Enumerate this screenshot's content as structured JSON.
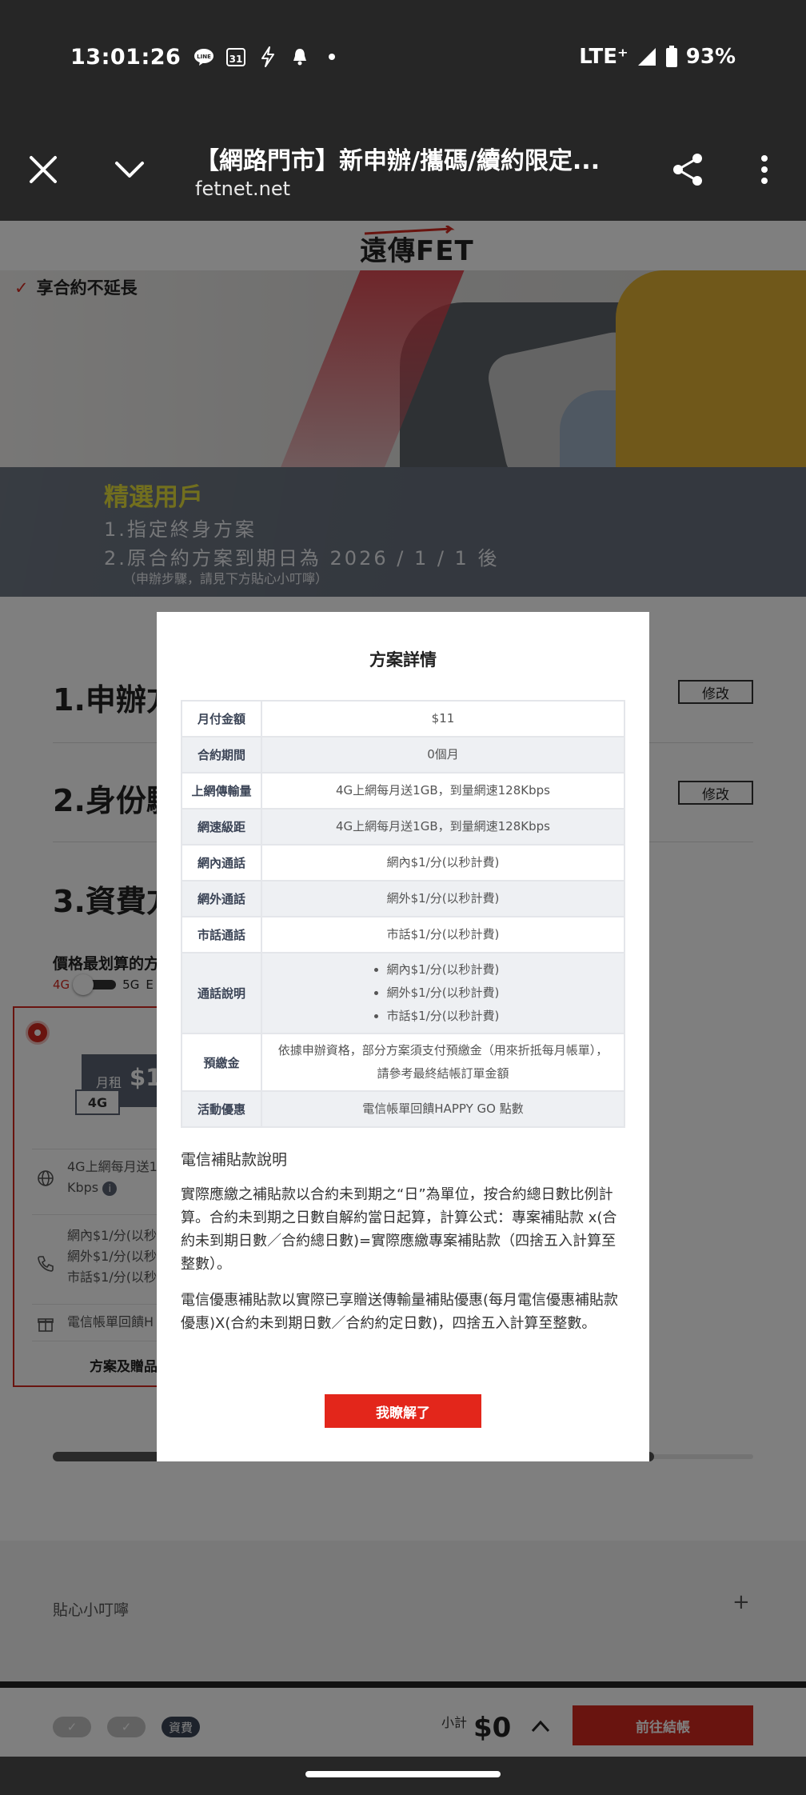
{
  "status_bar": {
    "time": "13:01:26",
    "icons": [
      "line-icon",
      "calendar-31-icon",
      "flash-icon",
      "bell-icon",
      "dot-icon"
    ],
    "calendar_day": "31",
    "network": "LTE⁺",
    "battery": "93%"
  },
  "browser": {
    "title": "【網路門市】新申辦/攜碼/續約限定...",
    "url": "fetnet.net"
  },
  "page": {
    "logo_text": "遠傳FET",
    "banner_check": "享合約不延長",
    "promo": {
      "heading": "精選用戶",
      "line1": "1.指定終身方案",
      "line2": "2.原合約方案到期日為 2026 / 1 / 1 後",
      "note": "（申辦步驟，請見下方貼心小叮嚀）"
    },
    "steps": [
      {
        "label": "1.申辦方",
        "edit": "修改"
      },
      {
        "label": "2.身份驗",
        "edit": "修改"
      },
      {
        "label": "3.資費方"
      }
    ],
    "price_filter_label": "價格最划算的方",
    "toggle": {
      "a": "4G",
      "b": "5G",
      "c": "E"
    },
    "card": {
      "monthly_label": "月租",
      "monthly_value": "$1",
      "badge": "4G",
      "feature_data": "4G上網每月送1",
      "feature_data2": "Kbps",
      "feature_calls": [
        "網內$1/分(以秒",
        "網外$1/分(以秒",
        "市話$1/分(以秒"
      ],
      "feature_gift": "電信帳單回饋H",
      "footer": "方案及贈品"
    },
    "tips_label": "貼心小叮嚀",
    "tips_plus": "+"
  },
  "bottom_bar": {
    "steps": [
      "✓",
      "✓",
      "資費"
    ],
    "subtotal_label": "小計",
    "subtotal_value": "$0",
    "checkout": "前往結帳"
  },
  "modal": {
    "title": "方案詳情",
    "rows": [
      {
        "k": "月付金額",
        "v": "$11"
      },
      {
        "k": "合約期間",
        "v": "0個月"
      },
      {
        "k": "上網傳輸量",
        "v": "4G上網每月送1GB，到量網速128Kbps"
      },
      {
        "k": "網速級距",
        "v": "4G上網每月送1GB，到量網速128Kbps"
      },
      {
        "k": "網內通話",
        "v": "網內$1/分(以秒計費)"
      },
      {
        "k": "網外通話",
        "v": "網外$1/分(以秒計費)"
      },
      {
        "k": "市話通話",
        "v": "市話$1/分(以秒計費)"
      }
    ],
    "call_notes_key": "通話說明",
    "call_notes": [
      "網內$1/分(以秒計費)",
      "網外$1/分(以秒計費)",
      "市話$1/分(以秒計費)"
    ],
    "deposit_key": "預繳金",
    "deposit_value": "依據申辦資格，部分方案須支付預繳金（用來折抵每月帳單），請參考最終結帳訂單金額",
    "promo_key": "活動優惠",
    "promo_value": "電信帳單回饋HAPPY GO 點數",
    "subsidy_heading": "電信補貼款說明",
    "para1": "實際應繳之補貼款以合約未到期之“日”為單位，按合約總日數比例計算。合約未到期之日數自解約當日起算，計算公式：專案補貼款 x(合約未到期日數／合約總日數)=實際應繳專案補貼款（四捨五入計算至整數）。",
    "para2": "電信優惠補貼款以實際已享贈送傳輸量補貼優惠(每月電信優惠補貼款優惠)X(合約未到期日數／合約約定日數)，四捨五入計算至整數。",
    "confirm": "我瞭解了"
  },
  "colors": {
    "brand_red": "#d3281f",
    "promo_yellow": "#e4df3c",
    "promo_bg": "#68717e",
    "dark_bar": "#262626"
  }
}
